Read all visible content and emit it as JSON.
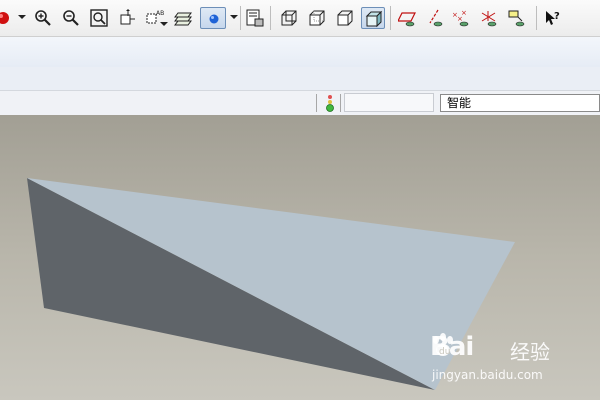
{
  "toolbar": {
    "icons": [
      "record-icon",
      "zoom-in-icon",
      "zoom-out-icon",
      "refit-icon",
      "reorient-icon",
      "saved-views-icon",
      "layers-icon",
      "display-style-icon",
      "view-manager-icon",
      "wireframe-icon",
      "hidden-line-icon",
      "no-hidden-icon",
      "shaded-icon",
      "datum-plane-icon",
      "datum-axis-icon",
      "datum-point-icon",
      "coordinate-system-icon",
      "annotation-icon",
      "context-help-icon"
    ]
  },
  "status_bar": {
    "filter_value": "智能"
  },
  "viewport": {
    "background_top": "#a29f94",
    "background_bottom": "#c9c7be",
    "model_light_face": "#b6c3cd",
    "model_dark_face": "#5f6469"
  },
  "watermark": {
    "logo": "Bai",
    "product": "经验",
    "url": "jingyan.baidu.com"
  }
}
